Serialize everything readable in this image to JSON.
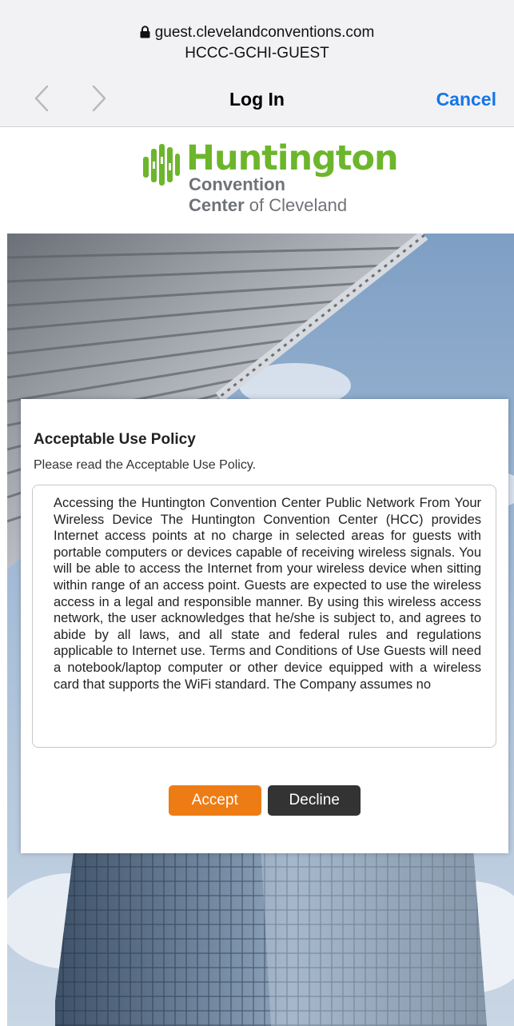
{
  "browser": {
    "url": "guest.clevelandconventions.com",
    "network_name": "HCCC-GCHI-GUEST",
    "title": "Log In",
    "cancel_label": "Cancel",
    "back_icon": "chevron-left-icon",
    "forward_icon": "chevron-right-icon",
    "lock_icon": "lock-icon",
    "accent_color": "#1476e6"
  },
  "logo": {
    "brand": "Huntington",
    "line2": "Convention",
    "line3_bold": "Center",
    "line3_rest": " of Cleveland",
    "brand_color": "#6cb62b",
    "text_color": "#6f7378"
  },
  "policy": {
    "title": "Acceptable Use Policy",
    "subtitle": "Please read the Acceptable Use Policy.",
    "text": "Accessing the Huntington Convention Center Public Network From Your Wireless Device The Huntington Convention Center (HCC) provides Internet access points at no charge in selected areas for guests with portable computers or devices capable of receiving wireless signals. You will be able to access the Internet from your wireless device when sitting within range of an access point. Guests are expected to use the wireless access in a legal and responsible manner. By using this wireless access network, the user acknowledges that he/she is subject to, and agrees to abide by all laws, and all state and federal rules and regulations applicable to Internet use. Terms and Conditions of Use Guests will need a notebook/laptop computer or other device equipped with a wireless card that supports the WiFi standard. The Company assumes no",
    "accept_label": "Accept",
    "decline_label": "Decline",
    "accept_color": "#ee7c14",
    "decline_color": "#333333"
  }
}
